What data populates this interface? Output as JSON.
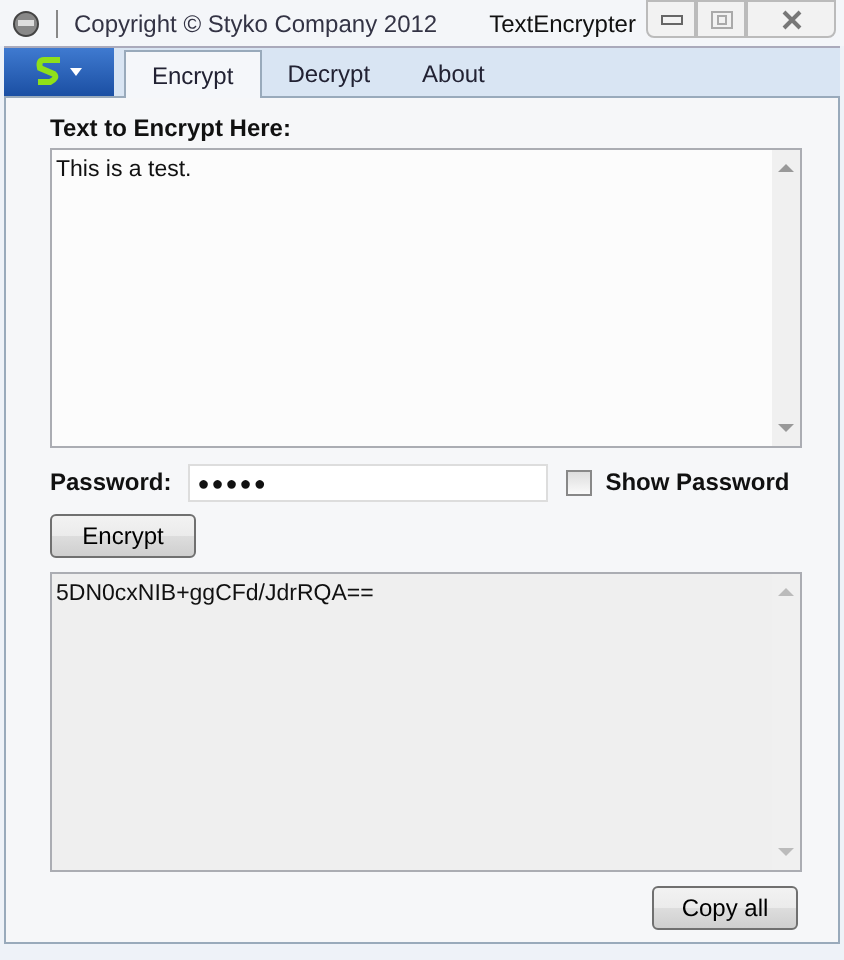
{
  "window": {
    "copyright": "Copyright © Styko Company 2012",
    "title": "TextEncrypter"
  },
  "tabs": [
    {
      "label": "Encrypt",
      "selected": true
    },
    {
      "label": "Decrypt",
      "selected": false
    },
    {
      "label": "About",
      "selected": false
    }
  ],
  "input": {
    "label": "Text to Encrypt Here:",
    "value": "This is a test."
  },
  "password": {
    "label": "Password:",
    "value": "●●●●●",
    "show_label": "Show Password",
    "checked": false
  },
  "encrypt_button": "Encrypt",
  "output": {
    "value": "5DN0cxNIB+ggCFd/JdrRQA=="
  },
  "copy_button": "Copy all"
}
